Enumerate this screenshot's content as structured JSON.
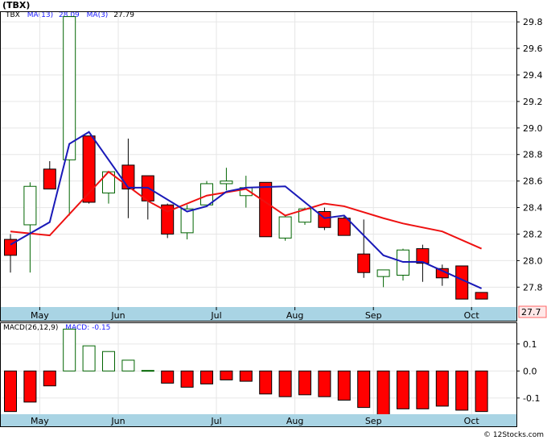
{
  "ticker": "(TBX)",
  "legend_main": {
    "symbol": "TBX",
    "ma13_label": "MA(13)",
    "ma13_value": "28.09",
    "ma3_label": "MA(3)",
    "ma3_value": "27.79"
  },
  "legend_macd": {
    "params": "MACD(26,12,9)",
    "label": "MACD:",
    "value": "-0.15"
  },
  "watermark": "© 12Stocks.com",
  "colors": {
    "up": "#006400",
    "down": "#ff0000",
    "ma13": "#ee1111",
    "ma3": "#1a1ab8",
    "axis_band": "#a9d4e4",
    "last_price_bg": "#ffe8e8",
    "last_price_border": "#ff6666"
  },
  "chart_data": [
    {
      "type": "candlestick",
      "title": "(TBX)",
      "months": [
        {
          "label": "May",
          "index": 1
        },
        {
          "label": "Jun",
          "index": 5
        },
        {
          "label": "Jul",
          "index": 10
        },
        {
          "label": "Aug",
          "index": 14
        },
        {
          "label": "Sep",
          "index": 18
        },
        {
          "label": "Oct",
          "index": 23
        }
      ],
      "ylim": [
        27.65,
        29.88
      ],
      "yticks": [
        27.8,
        28.0,
        28.2,
        28.4,
        28.6,
        28.8,
        29.0,
        29.2,
        29.4,
        29.6,
        29.8
      ],
      "ytick_labels": [
        "27.8",
        "28.0",
        "28.2",
        "28.4",
        "28.6",
        "28.8",
        "29.0",
        "29.2",
        "29.4",
        "29.6",
        "29.8"
      ],
      "last_price": "27.7",
      "candles": [
        {
          "o": 28.16,
          "h": 28.2,
          "l": 27.91,
          "c": 28.04
        },
        {
          "o": 28.27,
          "h": 28.59,
          "l": 27.91,
          "c": 28.56
        },
        {
          "o": 28.69,
          "h": 28.75,
          "l": 28.54,
          "c": 28.54
        },
        {
          "o": 28.76,
          "h": 29.84,
          "l": 28.34,
          "c": 29.84
        },
        {
          "o": 28.94,
          "h": 28.94,
          "l": 28.43,
          "c": 28.44
        },
        {
          "o": 28.51,
          "h": 28.67,
          "l": 28.43,
          "c": 28.67
        },
        {
          "o": 28.72,
          "h": 28.92,
          "l": 28.32,
          "c": 28.54
        },
        {
          "o": 28.64,
          "h": 28.64,
          "l": 28.31,
          "c": 28.45
        },
        {
          "o": 28.42,
          "h": 28.43,
          "l": 28.17,
          "c": 28.2
        },
        {
          "o": 28.21,
          "h": 28.42,
          "l": 28.16,
          "c": 28.39
        },
        {
          "o": 28.42,
          "h": 28.6,
          "l": 28.42,
          "c": 28.58
        },
        {
          "o": 28.58,
          "h": 28.7,
          "l": 28.53,
          "c": 28.6
        },
        {
          "o": 28.49,
          "h": 28.64,
          "l": 28.4,
          "c": 28.55
        },
        {
          "o": 28.59,
          "h": 28.59,
          "l": 28.18,
          "c": 28.18
        },
        {
          "o": 28.17,
          "h": 28.34,
          "l": 28.15,
          "c": 28.33
        },
        {
          "o": 28.29,
          "h": 28.4,
          "l": 28.27,
          "c": 28.39
        },
        {
          "o": 28.37,
          "h": 28.4,
          "l": 28.23,
          "c": 28.25
        },
        {
          "o": 28.32,
          "h": 28.34,
          "l": 28.19,
          "c": 28.19
        },
        {
          "o": 28.05,
          "h": 28.31,
          "l": 27.87,
          "c": 27.91
        },
        {
          "o": 27.88,
          "h": 27.93,
          "l": 27.8,
          "c": 27.93
        },
        {
          "o": 27.89,
          "h": 28.09,
          "l": 27.85,
          "c": 28.08
        },
        {
          "o": 28.09,
          "h": 28.12,
          "l": 27.84,
          "c": 27.98
        },
        {
          "o": 27.94,
          "h": 27.97,
          "l": 27.81,
          "c": 27.87
        },
        {
          "o": 27.96,
          "h": 27.96,
          "l": 27.71,
          "c": 27.71
        },
        {
          "o": 27.76,
          "h": 27.76,
          "l": 27.71,
          "c": 27.71
        }
      ],
      "ma13": [
        28.22,
        null,
        28.19,
        null,
        null,
        28.67,
        null,
        28.45,
        28.37,
        null,
        28.49,
        null,
        28.54,
        null,
        28.34,
        null,
        28.43,
        28.41,
        null,
        28.32,
        28.28,
        null,
        28.22,
        null,
        28.09
      ],
      "ma3": [
        28.12,
        null,
        28.29,
        28.88,
        28.97,
        null,
        28.55,
        28.55,
        null,
        28.37,
        28.41,
        28.52,
        28.55,
        null,
        28.56,
        null,
        28.32,
        28.34,
        null,
        28.04,
        27.99,
        27.99,
        null,
        null,
        27.79
      ]
    },
    {
      "type": "bar",
      "title": "MACD(26,12,9)",
      "ylim": [
        -0.16,
        0.18
      ],
      "yticks": [
        -0.1,
        0.0,
        0.1
      ],
      "ytick_labels": [
        "-0.1",
        "0.0",
        "0.1"
      ],
      "values": [
        -0.15,
        -0.115,
        -0.055,
        0.155,
        0.093,
        0.072,
        0.04,
        0.002,
        -0.045,
        -0.06,
        -0.048,
        -0.033,
        -0.038,
        -0.085,
        -0.095,
        -0.088,
        -0.095,
        -0.108,
        -0.135,
        -0.17,
        -0.14,
        -0.14,
        -0.13,
        -0.145,
        -0.15
      ]
    }
  ]
}
